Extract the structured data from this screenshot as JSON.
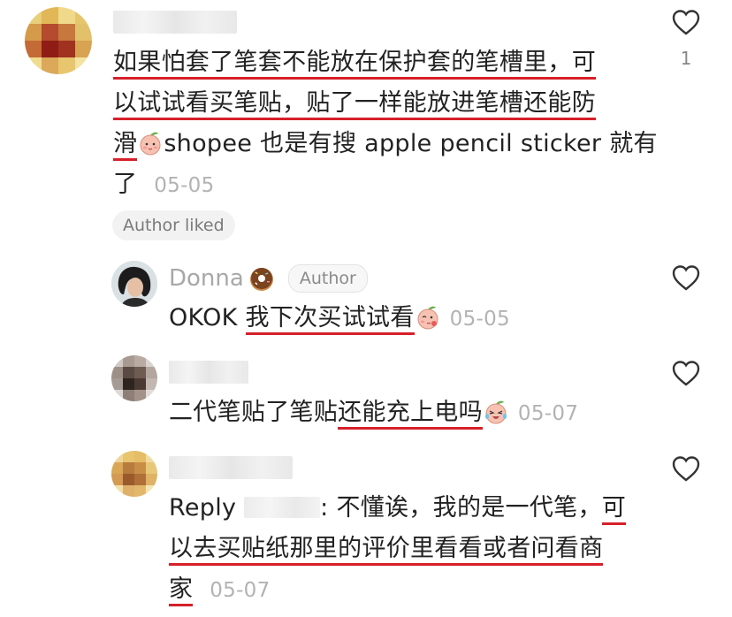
{
  "comments": {
    "main": {
      "text_part1": "如果怕套了笔套不能放在保护套的笔槽里，可",
      "text_part2": "以试试看买笔贴，贴了一样能放进笔槽还能防",
      "text_part3a": "滑",
      "text_part3b": "shopee 也是有搜 apple pencil sticker 就有",
      "text_part4": "了",
      "date": "05-05",
      "badge": "Author liked",
      "like_count": "1"
    },
    "reply1": {
      "username": "Donna",
      "author_tag": "Author",
      "text_prefix": "OKOK ",
      "text_underlined": "我下次买试试看",
      "date": "05-05"
    },
    "reply2": {
      "text_prefix": "二代笔贴了笔贴",
      "text_underlined": "还能充上电吗",
      "date": "05-07"
    },
    "reply3": {
      "reply_label": "Reply",
      "text_after_name": ": 不懂诶，我的是一代笔，",
      "text_underlined_1": "可",
      "text_underlined_2": "以去买贴纸那里的评价里看看或者问看商",
      "text_underlined_3": "家",
      "date": "05-07"
    }
  },
  "colors": {
    "underline": "#d6202a",
    "date_text": "#b3b3b3",
    "chip_bg": "#f2f2f2"
  },
  "icons": [
    "heart-outline-icon",
    "peach-emoji-icon",
    "donut-emoji-icon",
    "laughing-peach-emoji-icon"
  ]
}
